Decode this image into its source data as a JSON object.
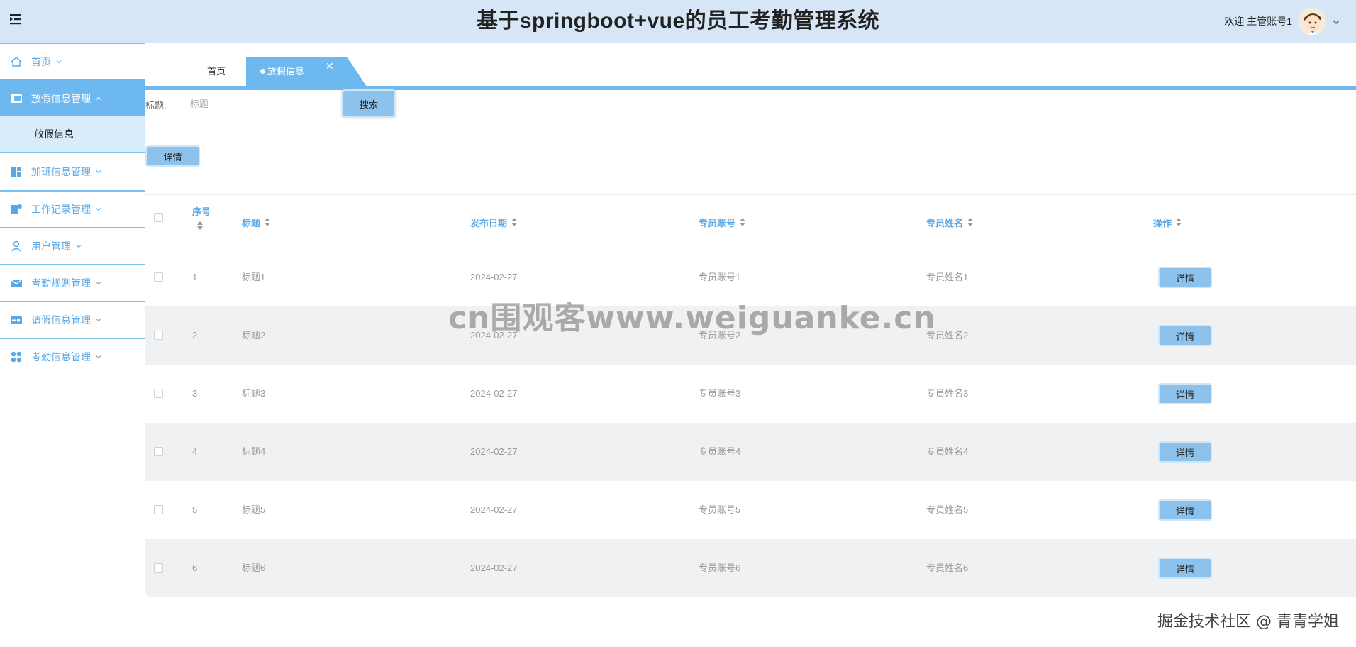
{
  "header": {
    "title": "基于springboot+vue的员工考勤管理系统",
    "welcome": "欢迎 主管账号1"
  },
  "sidebar": {
    "items": [
      {
        "label": "首页",
        "icon": "home-icon"
      },
      {
        "label": "放假信息管理",
        "icon": "list-icon",
        "active": true,
        "sub": [
          "放假信息"
        ]
      },
      {
        "label": "加班信息管理",
        "icon": "dashboard-icon"
      },
      {
        "label": "工作记录管理",
        "icon": "note-icon"
      },
      {
        "label": "用户管理",
        "icon": "user-icon"
      },
      {
        "label": "考勤规则管理",
        "icon": "mail-icon"
      },
      {
        "label": "请假信息管理",
        "icon": "card-icon"
      },
      {
        "label": "考勤信息管理",
        "icon": "grid-icon"
      }
    ]
  },
  "tabs": {
    "home": "首页",
    "active": "放假信息"
  },
  "search": {
    "label": "标题:",
    "placeholder": "标题",
    "button": "搜索"
  },
  "toolbar": {
    "detail": "详情"
  },
  "table": {
    "columns": [
      "序号",
      "标题",
      "发布日期",
      "专员账号",
      "专员姓名",
      "操作"
    ],
    "rows": [
      {
        "index": "1",
        "title": "标题1",
        "date": "2024-02-27",
        "account": "专员账号1",
        "name": "专员姓名1",
        "action": "详情"
      },
      {
        "index": "2",
        "title": "标题2",
        "date": "2024-02-27",
        "account": "专员账号2",
        "name": "专员姓名2",
        "action": "详情"
      },
      {
        "index": "3",
        "title": "标题3",
        "date": "2024-02-27",
        "account": "专员账号3",
        "name": "专员姓名3",
        "action": "详情"
      },
      {
        "index": "4",
        "title": "标题4",
        "date": "2024-02-27",
        "account": "专员账号4",
        "name": "专员姓名4",
        "action": "详情"
      },
      {
        "index": "5",
        "title": "标题5",
        "date": "2024-02-27",
        "account": "专员账号5",
        "name": "专员姓名5",
        "action": "详情"
      },
      {
        "index": "6",
        "title": "标题6",
        "date": "2024-02-27",
        "account": "专员账号6",
        "name": "专员姓名6",
        "action": "详情"
      }
    ]
  },
  "watermarks": {
    "main": "cn围观客www.weiguanke.cn",
    "corner": "掘金技术社区 @ 青青学姐"
  },
  "colors": {
    "header_bg": "#d6e6f6",
    "accent": "#6db8ef",
    "menu_text": "#5aa9e6",
    "submenu_bg": "#d9ecfb",
    "button_bg": "#8cc2ec",
    "stripe": "#f0f1f3"
  }
}
